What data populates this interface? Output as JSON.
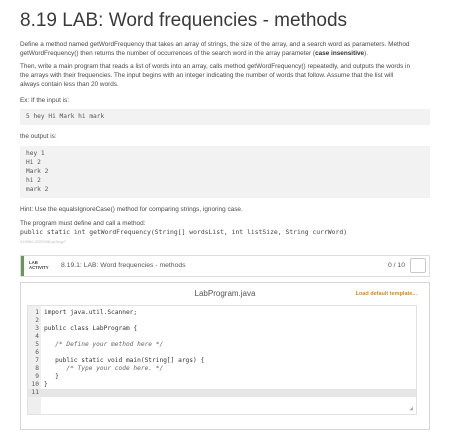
{
  "title": "8.19 LAB: Word frequencies - methods",
  "intro": {
    "line1": "Define a method named getWordFrequency that takes an array of strings, the size of the array, and a search word as parameters. Method",
    "line2_pre": "getWordFrequency() then returns the number of occurrences of the search word in the array parameter (",
    "line2_bold": "case insensitive",
    "line2_post": ")."
  },
  "main_desc": {
    "line1": "Then, write a main program that reads a list of words into an array, calls method getWordFrequency() repeatedly, and outputs the words in",
    "line2": "the arrays with their frequencies. The input begins with an integer indicating the number of words that follow. Assume that the list will",
    "line3": "always contain less than 20 words."
  },
  "input_label": "Ex: If the input is:",
  "input_example": "5 hey Hi Mark hi mark",
  "output_label": "the output is:",
  "output_lines": [
    "hey 1",
    "Hi 2",
    "Mark 2",
    "hi 2",
    "mark 2"
  ],
  "hint": "Hint: Use the equalsIgnoreCase() method for comparing strings, ignoring case.",
  "must_define": "The program must define and call a method:",
  "signature": "public static int getWordFrequency(String[] wordsList, int listSize, String currWord)",
  "tiny_id": "415960.2220398.qx3zqy7",
  "lab": {
    "tag_line1": "LAB",
    "tag_line2": "ACTIVITY",
    "title": "8.19.1: LAB: Word frequencies - methods",
    "score": "0 / 10"
  },
  "editor": {
    "filename": "LabProgram.java",
    "load_template": "Load default template...",
    "lines": [
      {
        "n": "1",
        "t": "import java.util.Scanner;"
      },
      {
        "n": "2",
        "t": ""
      },
      {
        "n": "3",
        "t": "public class LabProgram {"
      },
      {
        "n": "4",
        "t": ""
      },
      {
        "n": "5",
        "t": "   /* Define your method here */"
      },
      {
        "n": "6",
        "t": ""
      },
      {
        "n": "7",
        "t": "   public static void main(String[] args) {"
      },
      {
        "n": "8",
        "t": "      /* Type your code here. */"
      },
      {
        "n": "9",
        "t": "   }"
      },
      {
        "n": "10",
        "t": "}"
      },
      {
        "n": "11",
        "t": ""
      }
    ]
  }
}
